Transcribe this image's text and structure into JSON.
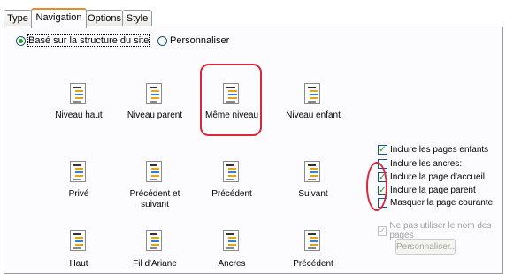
{
  "tabs": [
    {
      "label": "Type"
    },
    {
      "label": "Navigation"
    },
    {
      "label": "Options"
    },
    {
      "label": "Style"
    }
  ],
  "mode": {
    "structure_label": "Basé sur la structure du site",
    "custom_label": "Personnaliser",
    "selected": "structure"
  },
  "nav_options": [
    {
      "label": "Niveau haut"
    },
    {
      "label": "Niveau parent"
    },
    {
      "label": "Même niveau"
    },
    {
      "label": "Niveau enfant"
    },
    {
      "label": "Privé"
    },
    {
      "label": "Précédent et suivant"
    },
    {
      "label": "Précédent"
    },
    {
      "label": "Suivant"
    },
    {
      "label": "Haut"
    },
    {
      "label": "Fil d'Ariane"
    },
    {
      "label": "Ancres"
    },
    {
      "label": "Précédent"
    }
  ],
  "options": [
    {
      "label": "Inclure les pages enfants",
      "checked": true
    },
    {
      "label": "Inclure les ancres:",
      "checked": false
    },
    {
      "label": "Inclure la page d'accueil",
      "checked": true
    },
    {
      "label": "Inclure la page parent",
      "checked": true
    },
    {
      "label": "Masquer la page courante",
      "checked": false
    }
  ],
  "disabled_option": {
    "label": "Ne pas utiliser le nom des pages",
    "checked": true
  },
  "customize_button": "Personnaliser...",
  "colors": {
    "highlight": "#d9283a",
    "tab_accent": "#e68b2c",
    "check": "#21a121"
  }
}
